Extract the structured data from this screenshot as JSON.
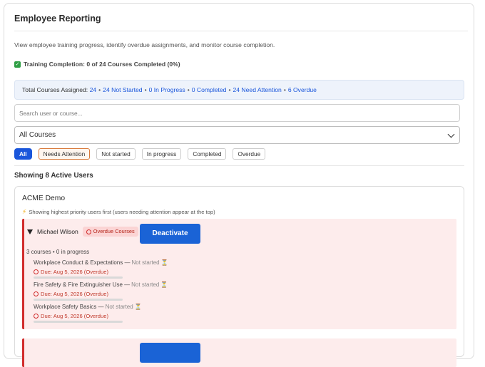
{
  "header": {
    "title": "Employee Reporting",
    "description": "View employee training progress, identify overdue assignments, and monitor course completion.",
    "completion": "Training Completion: 0 of 24 Courses Completed (0%)"
  },
  "summary": {
    "label": "Total Courses Assigned:",
    "total": "24",
    "not_started": "24 Not Started",
    "in_progress": "0 In Progress",
    "completed": "0 Completed",
    "need_attention": "24 Need Attention",
    "overdue": "6 Overdue",
    "separator": "•"
  },
  "search": {
    "placeholder": "Search user or course..."
  },
  "course_filter": {
    "selected": "All Courses"
  },
  "filters": [
    "All",
    "Needs Attention",
    "Not started",
    "In progress",
    "Completed",
    "Overdue"
  ],
  "showing": "Showing 8 Active Users",
  "organization": {
    "name": "ACME Demo",
    "priority_note": "Showing highest priority users first (users needing attention appear at the top)"
  },
  "users": [
    {
      "name": "Michael Wilson",
      "badge": "Overdue Courses",
      "action": "Deactivate",
      "stats": "3 courses • 0 in progress",
      "courses": [
        {
          "title": "Workplace Conduct & Expectations — ",
          "status": "Not started",
          "due": "Due: Aug 5, 2026 (Overdue)",
          "progress": 0
        },
        {
          "title": "Fire Safety & Fire Extinguisher Use — ",
          "status": "Not started",
          "due": "Due: Aug 5, 2026 (Overdue)",
          "progress": 0
        },
        {
          "title": "Workplace Safety Basics — ",
          "status": "Not started",
          "due": "Due: Aug 5, 2026 (Overdue)",
          "progress": 0
        }
      ]
    }
  ],
  "colors": {
    "accent": "#1a56db",
    "danger": "#d12d2d",
    "alert_bg": "#fdecec",
    "summary_bg": "#eef3fb"
  },
  "icons": {
    "completion": "check-icon",
    "priority": "bolt-icon",
    "badge": "clock-icon",
    "status": "hourglass-icon"
  }
}
